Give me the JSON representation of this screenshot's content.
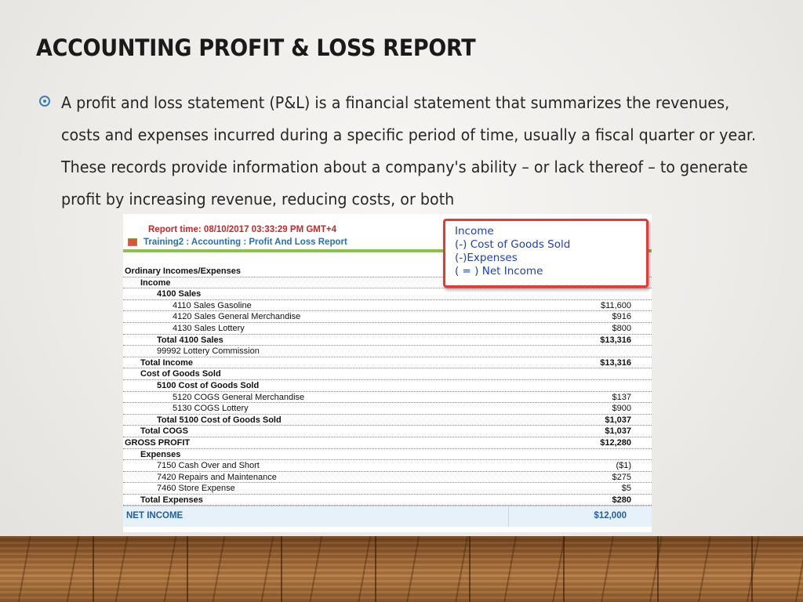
{
  "slide": {
    "title": "ACCOUNTING PROFIT & LOSS REPORT",
    "bullet_text": "A profit and loss statement (P&L) is a financial statement that summarizes the revenues, costs and expenses incurred during a specific period of time, usually a fiscal quarter or year. These records provide information about a company's ability – or lack thereof – to generate profit by increasing revenue, reducing costs, or both"
  },
  "report": {
    "report_time": "Report time: 08/10/2017 03:33:29 PM GMT+4",
    "path": "Training2 : Accounting : Profit And Loss Report",
    "callout": [
      "Income",
      "(-) Cost of Goods Sold",
      "(-)Expenses",
      "( = ) Net Income"
    ],
    "rows": [
      {
        "label": "Ordinary Incomes/Expenses",
        "amount": "",
        "level": 0,
        "bold": true
      },
      {
        "label": "Income",
        "amount": "",
        "level": 1,
        "bold": true
      },
      {
        "label": "4100 Sales",
        "amount": "",
        "level": 2,
        "bold": true
      },
      {
        "label": "4110 Sales Gasoline",
        "amount": "$11,600",
        "level": 3,
        "bold": false
      },
      {
        "label": "4120 Sales General Merchandise",
        "amount": "$916",
        "level": 3,
        "bold": false
      },
      {
        "label": "4130 Sales Lottery",
        "amount": "$800",
        "level": 3,
        "bold": false
      },
      {
        "label": "Total 4100 Sales",
        "amount": "$13,316",
        "level": 2,
        "bold": true
      },
      {
        "label": "99992 Lottery Commission",
        "amount": "",
        "level": 2,
        "bold": false
      },
      {
        "label": "Total Income",
        "amount": "$13,316",
        "level": 1,
        "bold": true
      },
      {
        "label": "Cost of Goods Sold",
        "amount": "",
        "level": 1,
        "bold": true
      },
      {
        "label": "5100 Cost of Goods Sold",
        "amount": "",
        "level": 2,
        "bold": true
      },
      {
        "label": "5120 COGS General Merchandise",
        "amount": "$137",
        "level": 3,
        "bold": false
      },
      {
        "label": "5130 COGS Lottery",
        "amount": "$900",
        "level": 3,
        "bold": false
      },
      {
        "label": "Total 5100 Cost of Goods Sold",
        "amount": "$1,037",
        "level": 2,
        "bold": true
      },
      {
        "label": "Total COGS",
        "amount": "$1,037",
        "level": 1,
        "bold": true
      },
      {
        "label": "GROSS PROFIT",
        "amount": "$12,280",
        "level": 0,
        "bold": true
      },
      {
        "label": "Expenses",
        "amount": "",
        "level": 1,
        "bold": true
      },
      {
        "label": "7150 Cash Over and Short",
        "amount": "($1)",
        "level": 2,
        "bold": false
      },
      {
        "label": "7420 Repairs and Maintenance",
        "amount": "$275",
        "level": 2,
        "bold": false
      },
      {
        "label": "7460 Store Expense",
        "amount": "$5",
        "level": 2,
        "bold": false
      },
      {
        "label": "Total Expenses",
        "amount": "$280",
        "level": 1,
        "bold": true
      }
    ],
    "net_income_label": "NET INCOME",
    "net_income_value": "$12,000"
  }
}
